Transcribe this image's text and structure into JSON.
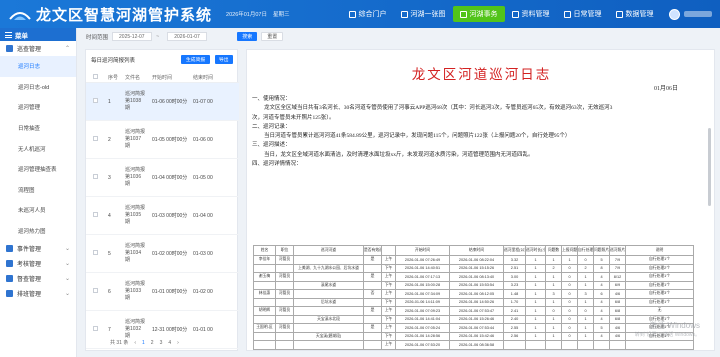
{
  "header": {
    "title": "龙文区智慧河湖管护系统",
    "date": "2026年01月07日",
    "weekday": "星期三",
    "nav": [
      {
        "label": "综合门户",
        "active": false
      },
      {
        "label": "河湖一张图",
        "active": false
      },
      {
        "label": "河湖事务",
        "active": true
      },
      {
        "label": "资料管理",
        "active": false
      },
      {
        "label": "日常管理",
        "active": false
      },
      {
        "label": "数据管理",
        "active": false
      }
    ],
    "accent": "#1b78d8",
    "active_color": "#52c41a"
  },
  "sidebar": {
    "menu_label": "菜单",
    "groups": [
      {
        "label": "巡查管理",
        "expanded": true,
        "items": [
          {
            "label": "巡河日志",
            "active": true
          },
          {
            "label": "巡河日志-old",
            "active": false
          },
          {
            "label": "巡河管理",
            "active": false
          },
          {
            "label": "日常抽查",
            "active": false
          },
          {
            "label": "无人机巡河",
            "active": false
          },
          {
            "label": "巡河管理抽查表",
            "active": false
          },
          {
            "label": "流程图",
            "active": false
          },
          {
            "label": "未巡河人员",
            "active": false
          },
          {
            "label": "巡河热力图",
            "active": false
          }
        ]
      },
      {
        "label": "事件管理",
        "expanded": false,
        "items": []
      },
      {
        "label": "考核管理",
        "expanded": false,
        "items": []
      },
      {
        "label": "督查管理",
        "expanded": false,
        "items": []
      },
      {
        "label": "排班管理",
        "expanded": false,
        "items": []
      }
    ]
  },
  "filter": {
    "label": "时间范围",
    "start": "2025-12-07",
    "end": "2026-01-07",
    "separator": "~",
    "query_label": "搜索",
    "reset_label": "重置"
  },
  "list": {
    "title": "每日巡河简报列表",
    "import_label": "生成简报",
    "export_label": "导出",
    "headers": [
      "序号",
      "文件名",
      "开始时间",
      "结束时间"
    ],
    "rows": [
      {
        "no": "1",
        "name": [
          "巡河简报",
          "第1038",
          "期"
        ],
        "start": "01-06 00时00分",
        "end": "01-07 00",
        "selected": true
      },
      {
        "no": "2",
        "name": [
          "巡河简报",
          "第1037",
          "期"
        ],
        "start": "01-05 00时00分",
        "end": "01-06 00",
        "selected": false
      },
      {
        "no": "3",
        "name": [
          "巡河简报",
          "第1036",
          "期"
        ],
        "start": "01-04 00时00分",
        "end": "01-05 00",
        "selected": false
      },
      {
        "no": "4",
        "name": [
          "巡河简报",
          "第1035",
          "期"
        ],
        "start": "01-03 00时00分",
        "end": "01-04 00",
        "selected": false
      },
      {
        "no": "5",
        "name": [
          "巡河简报",
          "第1034",
          "期"
        ],
        "start": "01-02 00时00分",
        "end": "01-03 00",
        "selected": false
      },
      {
        "no": "6",
        "name": [
          "巡河简报",
          "第1033",
          "期"
        ],
        "start": "01-01 00时00分",
        "end": "01-02 00",
        "selected": false
      },
      {
        "no": "7",
        "name": [
          "巡河简报",
          "第1032",
          "期"
        ],
        "start": "12-31 00时00分",
        "end": "01-01 00",
        "selected": false
      }
    ],
    "pager": {
      "total": "共 31 条",
      "prev": "‹",
      "pages": [
        "1",
        "2",
        "3",
        "4"
      ],
      "current": "1",
      "next": "›"
    }
  },
  "doc": {
    "title": "龙文区河道巡河日志",
    "date": "01月06日",
    "lines": [
      {
        "cls": "h",
        "text": "一、使用情况："
      },
      {
        "cls": "p",
        "text": "龙文区全区域当日共有3名河长、30名河道专管员使用了河事云APP巡河68次（其中：河长巡河3次，专管员巡河65次，有效巡河63次，无效巡河3"
      },
      {
        "cls": "",
        "text": "次，河道专管员未开照片125张）。"
      },
      {
        "cls": "h",
        "text": "二、巡河记录："
      },
      {
        "cls": "p",
        "text": "当日河道专管员累计巡河河道41条584.89公里，巡河记录中，发现问题115个，问题照片122张（上报问题20个，自行处理95个）"
      },
      {
        "cls": "h",
        "text": "三、巡河描述："
      },
      {
        "cls": "p",
        "text": "当日，龙文区全域河道水面清洁，及时清理水面垃圾xx斤，未发现河道水质污染，河道管理范围内无河道四乱。"
      },
      {
        "cls": "h",
        "text": "四、巡河详情情况："
      }
    ],
    "table_headers": [
      "姓名",
      "职位",
      "巡河河道",
      "是否有效巡河",
      "",
      "开始时间",
      "结束时间",
      "巡河里程(公里)",
      "巡河时长(小时)",
      "问题数",
      "上报问题",
      "自行处理数",
      "问题照片",
      "巡河照片",
      "说明"
    ],
    "table_rows": [
      [
        "李佳年",
        "河管员",
        "",
        "是",
        "上午",
        "2026-01-06 07:26:49",
        "2026-01-06 08:22:04",
        "3.32",
        "1",
        "1",
        "1",
        "0",
        "5",
        "7/9",
        "自行处理1个"
      ],
      [
        "",
        "",
        "上美湖、九十九湖水公园、后坑水道",
        "",
        "下午",
        "2026-01-06 14:40:51",
        "2026-01-06 15:15:26",
        "2.51",
        "1",
        "2",
        "0",
        "2",
        "8",
        "7/9",
        "自行处理2个"
      ],
      [
        "谢玉梅",
        "河管员",
        "",
        "是",
        "上午",
        "2026-01-06 07:17:13",
        "2026-01-06 08:13:40",
        "3.00",
        "1",
        "1",
        "0",
        "1",
        "4",
        "8/12",
        "自行处理1个"
      ],
      [
        "",
        "",
        "溪尾水道",
        "",
        "下午",
        "2026-01-06 15:00:28",
        "2026-01-06 15:53:54",
        "3.23",
        "1",
        "1",
        "0",
        "1",
        "4",
        "6/9",
        "自行处理1个"
      ],
      [
        "林佳惠",
        "河管员",
        "",
        "否",
        "上午",
        "2026-01-06 07:34:09",
        "2026-01-06 08:12:05",
        "1.48",
        "1",
        "3",
        "0",
        "3",
        "6",
        "4/6",
        "自行处理3个"
      ],
      [
        "",
        "",
        "后坑水道",
        "",
        "下午",
        "2026-01-06 14:11:09",
        "2026-01-06 14:50:26",
        "1.70",
        "1",
        "1",
        "0",
        "1",
        "4",
        "6/8",
        "自行处理1个"
      ],
      [
        "胡明辉",
        "河管员",
        "",
        "是",
        "上午",
        "2026-01-06 07:09:23",
        "2026-01-06 07:53:47",
        "2.41",
        "1",
        "0",
        "0",
        "0",
        "4",
        "6/8",
        "无"
      ],
      [
        "",
        "",
        "天宝溪水北段",
        "",
        "下午",
        "2026-01-06 14:41:04",
        "2026-01-06 15:26:46",
        "2.40",
        "1",
        "1",
        "0",
        "1",
        "4",
        "6/8",
        "自行处理1个"
      ],
      [
        "王国明-区",
        "河管员",
        "",
        "是",
        "上午",
        "2026-01-06 07:05:24",
        "2026-01-06 07:53:44",
        "2.55",
        "1",
        "1",
        "0",
        "1",
        "5",
        "4/6",
        "自行处理1个"
      ],
      [
        "",
        "",
        "天宝溪(碧湖段)",
        "",
        "下午",
        "2026-01-06 14:28:56",
        "2026-01-06 15:42:46",
        "2.56",
        "1",
        "1",
        "0",
        "1",
        "4",
        "4/6",
        "自行处理1个"
      ],
      [
        "",
        "",
        "",
        "",
        "上午",
        "2026-01-06 07:53:20",
        "2026-01-06 08:36:58",
        "",
        "",
        "",
        "",
        "",
        "",
        "",
        ""
      ]
    ]
  },
  "watermark": {
    "line1": "激活 Windows",
    "line2": "转到\"设置\"以激活 Windows。"
  }
}
